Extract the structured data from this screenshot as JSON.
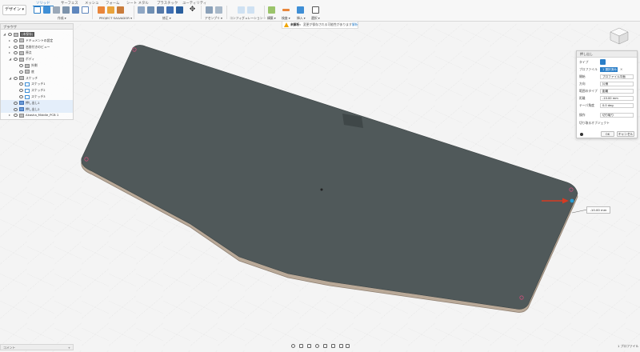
{
  "toolbar": {
    "workspace": "デザイン ▾",
    "tabs": [
      "ソリッド",
      "サーフェス",
      "メッシュ",
      "フォーム",
      "シート メタル",
      "プラスチック",
      "ユーティリティ"
    ],
    "groups": [
      "作成 ▾",
      "PROJECT SALVADOR ▾",
      "修正 ▾",
      "アセンブリ ▾",
      "コンフィグュレーション ▾",
      "構築 ▾",
      "検査 ▾",
      "挿入 ▾",
      "選択 ▾"
    ]
  },
  "warning": {
    "label": "未解析:",
    "message": "変更が保存される可能性があります",
    "link": "解析"
  },
  "browser": {
    "title": "ブラウザ",
    "rows": [
      {
        "label": "(未保存)",
        "indent": 0,
        "icon": "root",
        "arrow": "◢"
      },
      {
        "label": "ドキュメントの設定",
        "indent": 1,
        "icon": "gear",
        "arrow": "▸"
      },
      {
        "label": "名前付きのビュー",
        "indent": 1,
        "icon": "folder",
        "arrow": "▸"
      },
      {
        "label": "原点",
        "indent": 1,
        "icon": "folder",
        "arrow": "▸"
      },
      {
        "label": "ボディ",
        "indent": 1,
        "icon": "folder",
        "arrow": "◢"
      },
      {
        "label": "外側",
        "indent": 2,
        "icon": "body",
        "arrow": ""
      },
      {
        "label": "底",
        "indent": 2,
        "icon": "body",
        "arrow": ""
      },
      {
        "label": "スケッチ",
        "indent": 1,
        "icon": "folder",
        "arrow": "◢"
      },
      {
        "label": "スケッチ1",
        "indent": 2,
        "icon": "sketch",
        "arrow": ""
      },
      {
        "label": "スケッチ2",
        "indent": 2,
        "icon": "sketch",
        "arrow": ""
      },
      {
        "label": "スケッチ3",
        "indent": 2,
        "icon": "sketch",
        "arrow": ""
      },
      {
        "label": "押し出し1",
        "indent": 1,
        "icon": "feature",
        "arrow": ""
      },
      {
        "label": "押し出し2",
        "indent": 1,
        "icon": "feature",
        "arrow": ""
      },
      {
        "label": "Akasha_Middle_PCB 1",
        "indent": 1,
        "icon": "component",
        "arrow": "▸"
      }
    ]
  },
  "comments": {
    "label": "コメント",
    "plus": "+"
  },
  "dialog": {
    "title": "押し出し",
    "rows": [
      {
        "label": "タイプ",
        "value": ""
      },
      {
        "label": "プロファイル",
        "value": "1 選択済み"
      },
      {
        "label": "開始",
        "value": "プロファイル平面"
      },
      {
        "label": "方向",
        "value": "片側"
      },
      {
        "label": "範囲のタイプ",
        "value": "距離"
      },
      {
        "label": "距離",
        "value": "-10.00 mm"
      },
      {
        "label": "テーパ角度",
        "value": "0.0 deg"
      },
      {
        "label": "操作",
        "value": "切り取り"
      }
    ],
    "objects_to_cut": "切り取るオブジェクト",
    "ok": "OK",
    "cancel": "キャンセル"
  },
  "distance_input": "-10.00 mm",
  "status_bar": "1 プロファイル",
  "colors": {
    "plate": "#50595a",
    "plate_edge": "#b9a998",
    "accent": "#2a7ec7",
    "arrow": "#d63a22"
  }
}
